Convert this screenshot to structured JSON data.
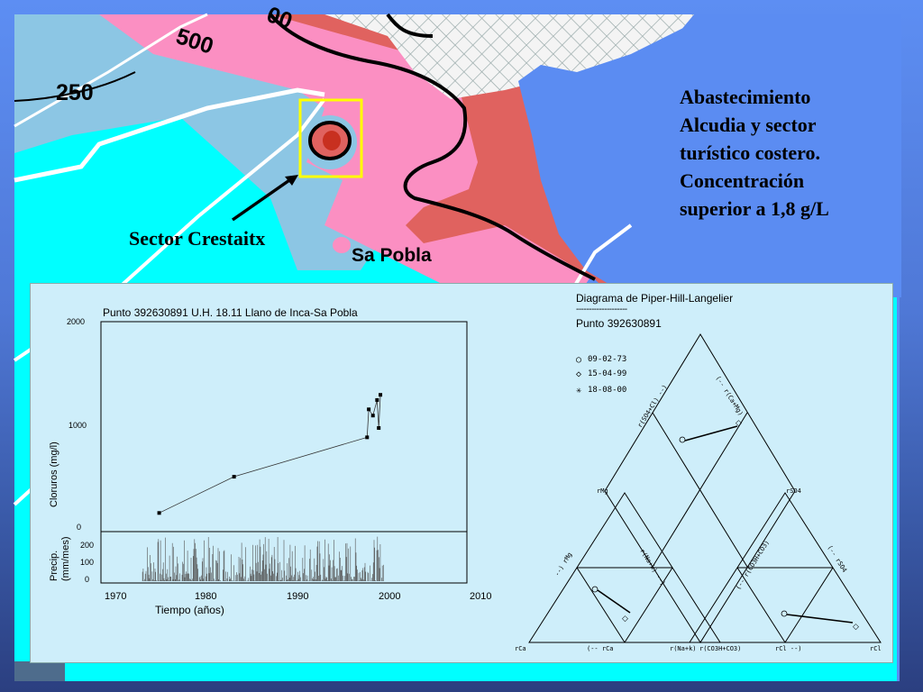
{
  "slide": {
    "title_lines": [
      "Abastecimiento",
      "Alcudia y sector",
      "turístico costero.",
      "Concentración",
      "superior a 1,8 g/L"
    ]
  },
  "map": {
    "contours": {
      "c500": "500",
      "c250": "250",
      "c_top": "00"
    },
    "sector_label": "Sector Crestaitx",
    "town_label": "Sa Pobla",
    "colors": {
      "cyan": "#00ffff",
      "lightblue": "#8cc6e4",
      "pink": "#fb8fc2",
      "red": "#e0625f",
      "darkred": "#c83020",
      "sea": "#5b8cf2",
      "highlight": "#ffff00"
    }
  },
  "chart": {
    "title": "Punto 392630891 U.H. 18.11 Llano de Inca-Sa Pobla",
    "xlabel": "Tiempo (años)",
    "ylabel": "Cloruros (mg/l)",
    "precip_label_1": "Precip.",
    "precip_label_2": "(mm/mes)",
    "y_ticks": [
      "2000",
      "1000",
      "0"
    ],
    "precip_ticks": [
      "200",
      "100",
      "0"
    ],
    "x_ticks": [
      "1970",
      "1980",
      "1990",
      "2000",
      "2010"
    ]
  },
  "chart_data": {
    "type": "line",
    "title": "Punto 392630891 U.H. 18.11 Llano de Inca-Sa Pobla",
    "xlabel": "Tiempo (años)",
    "ylabel": "Cloruros (mg/l)",
    "xlim": [
      1966,
      2010
    ],
    "ylim": [
      0,
      2000
    ],
    "series": [
      {
        "x": [
          1973,
          1982,
          1998,
          1998.2,
          1998.7,
          1999.2,
          1999.4,
          1999.6
        ],
        "y": [
          180,
          530,
          910,
          1180,
          1120,
          1270,
          1000,
          1320
        ]
      }
    ],
    "precip_ylim": [
      0,
      250
    ],
    "precip_xlim": [
      1971,
      2000
    ]
  },
  "piper": {
    "title": "Diagrama de Piper-Hill-Langelier",
    "title_underline": "--------------------",
    "subtitle": "Punto 392630891",
    "legend": [
      {
        "symbol": "○",
        "label": "09-02-73"
      },
      {
        "symbol": "◇",
        "label": "15-04-99"
      },
      {
        "symbol": "✳",
        "label": "18-08-00"
      }
    ],
    "axis_labels": {
      "rCa": "rCa",
      "rCa_arrow": "(-- rCa",
      "rNaK": "r(Na+k)",
      "rCO3": "r(CO3H+CO3)",
      "rCl_arrow": "rCl --)",
      "rCl": "rCl",
      "rMg": "rMg",
      "rSO4": "rSO4",
      "rMg_arrow": "--) rMg",
      "rNaK_arrow": "r(Na+k) --)",
      "rSO4Cl": "r(SO4+Cl) --)",
      "rCaMg": "(-- r(Ca+Mg)",
      "rCO3_arrow": "(-- r(CO3H+CO3)",
      "rSO4_arrow": "(-- rSO4"
    }
  }
}
